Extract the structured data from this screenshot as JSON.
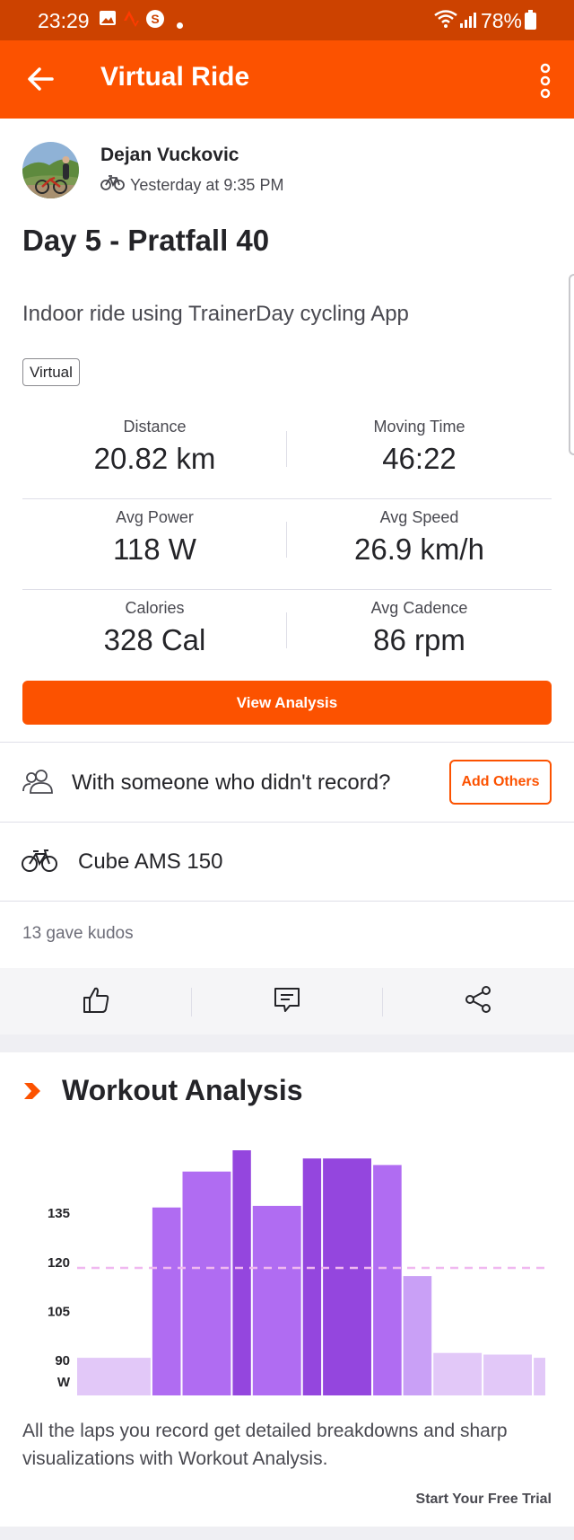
{
  "status_bar": {
    "time": "23:29",
    "battery": "78%"
  },
  "app_bar": {
    "title": "Virtual Ride"
  },
  "athlete": {
    "name": "Dejan Vuckovic",
    "meta": "Yesterday at 9:35 PM"
  },
  "activity": {
    "title": "Day 5 - Pratfall 40",
    "description": "Indoor ride using TrainerDay cycling App",
    "tag": "Virtual"
  },
  "stats": [
    {
      "left": {
        "label": "Distance",
        "value": "20.82 km"
      },
      "right": {
        "label": "Moving Time",
        "value": "46:22"
      }
    },
    {
      "left": {
        "label": "Avg Power",
        "value": "118 W"
      },
      "right": {
        "label": "Avg Speed",
        "value": "26.9 km/h"
      }
    },
    {
      "left": {
        "label": "Calories",
        "value": "328 Cal"
      },
      "right": {
        "label": "Avg Cadence",
        "value": "86 rpm"
      }
    }
  ],
  "buttons": {
    "view_analysis": "View Analysis",
    "add_others": "Add Others"
  },
  "with_someone": {
    "text": "With someone who didn't record?"
  },
  "gear": {
    "name": "Cube AMS 150"
  },
  "kudos": {
    "text": "13 gave kudos"
  },
  "workout_analysis": {
    "title": "Workout Analysis",
    "description": "All the laps you record get detailed breakdowns and sharp visualizations with Workout Analysis.",
    "cta": "Start Your Free Trial"
  },
  "colors": {
    "brand": "#fc5200",
    "status_bar": "#cc4200",
    "bar_light": "#e2c8f8",
    "bar_mid": "#c9a0f6",
    "bar_purple": "#b06cf2",
    "bar_dark": "#9446de",
    "avg_line": "#f0b8f0"
  },
  "chart_data": {
    "type": "bar",
    "ylabel": "W",
    "yticks": [
      90,
      105,
      120,
      135
    ],
    "ylim": [
      79,
      153
    ],
    "average_line": 118,
    "grid": false,
    "bars": [
      {
        "width_min": 4.5,
        "value": 90.5,
        "shade": "light"
      },
      {
        "width_min": 1.8,
        "value": 136.5,
        "shade": "purple"
      },
      {
        "width_min": 3.0,
        "value": 147.5,
        "shade": "purple"
      },
      {
        "width_min": 1.2,
        "value": 154,
        "shade": "dark"
      },
      {
        "width_min": 3.0,
        "value": 137,
        "shade": "purple"
      },
      {
        "width_min": 1.2,
        "value": 151.5,
        "shade": "dark"
      },
      {
        "width_min": 3.0,
        "value": 151.5,
        "shade": "dark"
      },
      {
        "width_min": 1.8,
        "value": 149.5,
        "shade": "purple"
      },
      {
        "width_min": 1.8,
        "value": 115.5,
        "shade": "mid"
      },
      {
        "width_min": 3.0,
        "value": 92,
        "shade": "light"
      },
      {
        "width_min": 3.0,
        "value": 91.5,
        "shade": "light"
      },
      {
        "width_min": 0.8,
        "value": 90.5,
        "shade": "light"
      }
    ]
  }
}
